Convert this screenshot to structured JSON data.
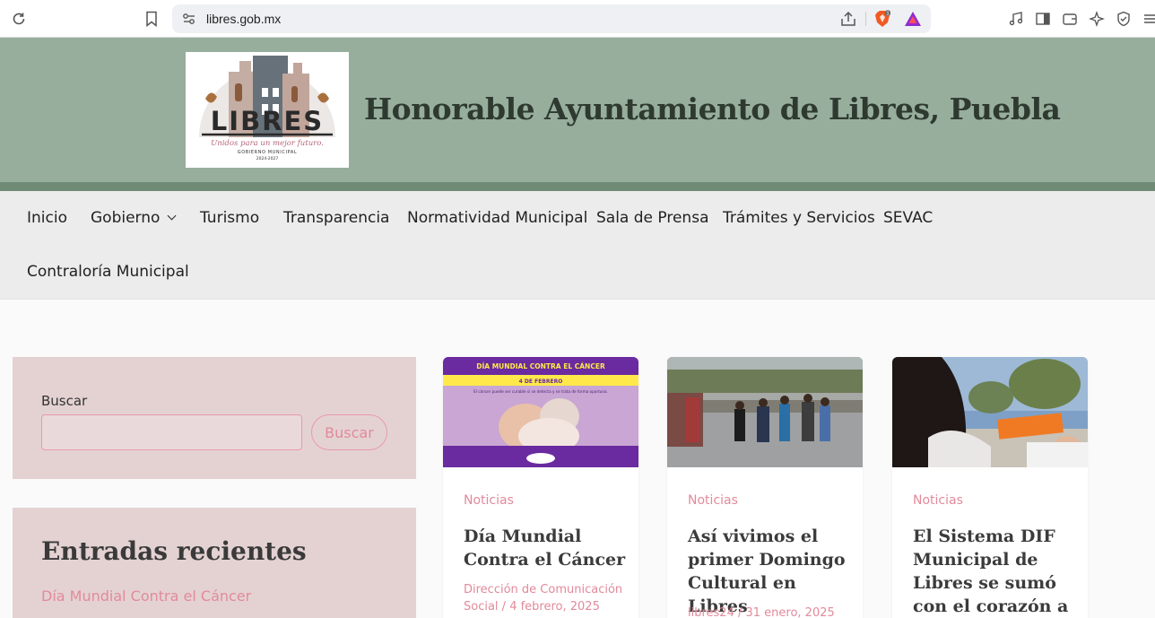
{
  "browser": {
    "url": "libres.gob.mx",
    "brave_badge": "1"
  },
  "header": {
    "site_title": "Honorable Ayuntamiento de Libres, Puebla",
    "logo": {
      "wordmark": "LIBRES",
      "tagline": "Unidos para un mejor futuro.",
      "subtitle": "GOBIERNO MUNICIPAL",
      "years": "2024-2027"
    }
  },
  "nav": {
    "items": [
      {
        "label": "Inicio"
      },
      {
        "label": "Gobierno",
        "has_dropdown": true
      },
      {
        "label": "Turismo"
      },
      {
        "label": "Transparencia"
      },
      {
        "label": "Normatividad Municipal"
      },
      {
        "label": "Sala de Prensa"
      },
      {
        "label": "Trámites y Servicios"
      },
      {
        "label": "SEVAC"
      },
      {
        "label": "Contraloría Municipal"
      }
    ]
  },
  "sidebar": {
    "search": {
      "label": "Buscar",
      "input_value": "",
      "button_label": "Buscar"
    },
    "recent": {
      "title": "Entradas recientes",
      "items": [
        "Día Mundial Contra el Cáncer"
      ]
    }
  },
  "posts": [
    {
      "category": "Noticias",
      "title": "Día Mundial Contra el Cáncer",
      "author": "Dirección de Comunicación Social",
      "date": "4 febrero, 2025",
      "meta": "Dirección de Comunicación Social / 4 febrero, 2025",
      "image_banner": "DÍA MUNDIAL CONTRA EL CÁNCER",
      "image_sub": "4 DE FEBRERO",
      "image_text": "El cáncer puede ser curable si se detecta y se trata de forma oportuna."
    },
    {
      "category": "Noticias",
      "title": "Así vivimos el primer Domingo Cultural en Libres",
      "meta": "libres24 / 31 enero, 2025"
    },
    {
      "category": "Noticias",
      "title": "El Sistema DIF Municipal de Libres se sumó con el corazón a la",
      "meta": ""
    }
  ],
  "colors": {
    "header_bg": "#98ae9d",
    "header_band": "#6f8b75",
    "nav_bg": "#ececec",
    "widget_bg": "#e4d2d3",
    "accent_pink": "#e28a9a"
  }
}
